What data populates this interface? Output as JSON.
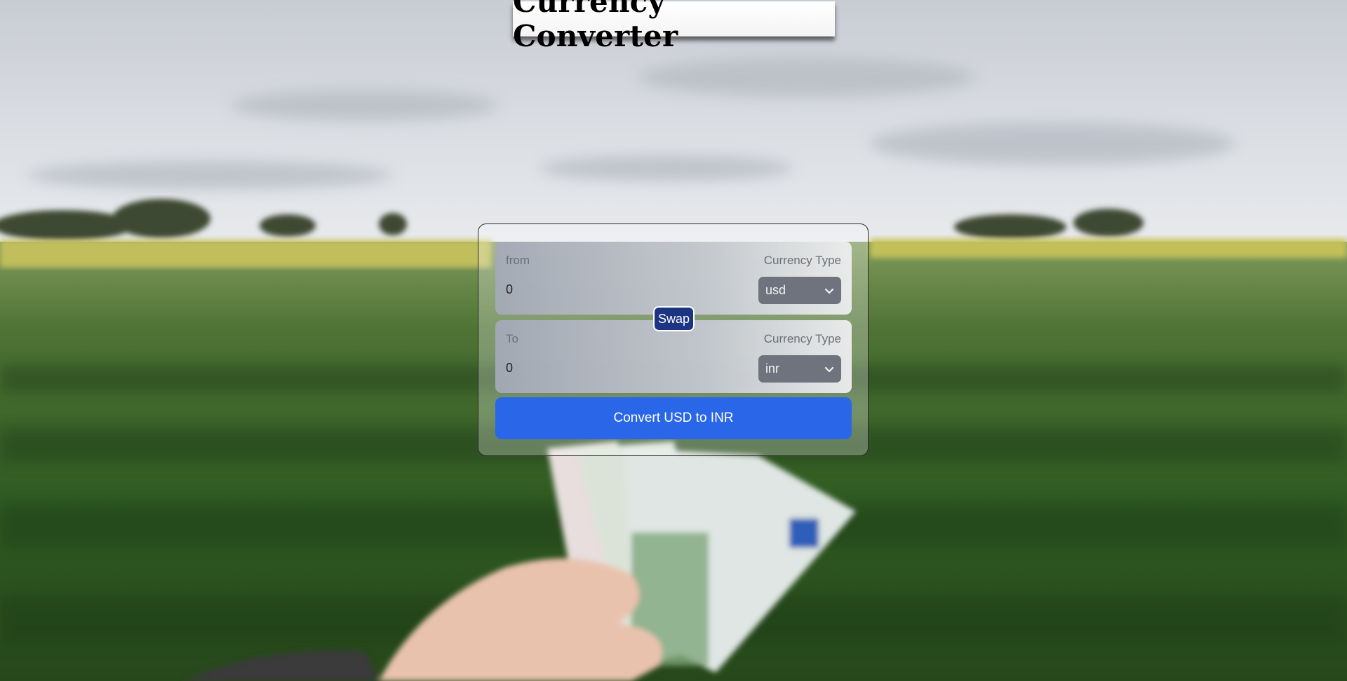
{
  "header": {
    "title": "Currency Converter"
  },
  "converter": {
    "from": {
      "label": "from",
      "type_label": "Currency Type",
      "amount": "0",
      "currency": "usd"
    },
    "swap_label": "Swap",
    "to": {
      "label": "To",
      "type_label": "Currency Type",
      "amount": "0",
      "currency": "inr"
    },
    "convert_label": "Convert USD to INR"
  },
  "colors": {
    "convert_button": "#2a67e8",
    "swap_button": "#1c3583",
    "select_bg": "#6f737d"
  },
  "background": {
    "image_icon": "field-with-money-photo"
  }
}
